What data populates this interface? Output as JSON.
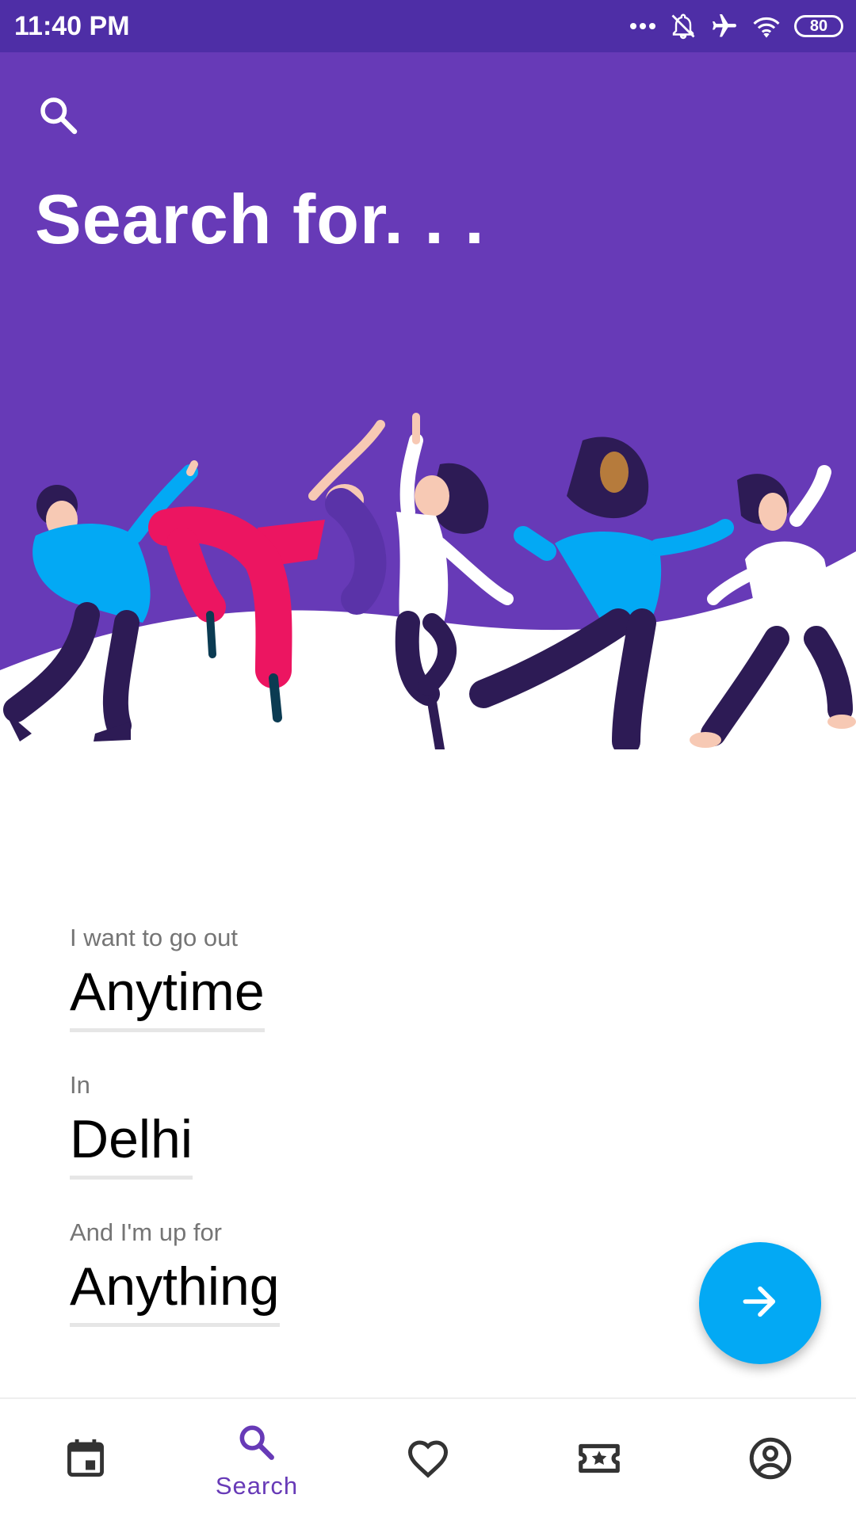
{
  "status_bar": {
    "time": "11:40 PM",
    "battery": "80",
    "icons": [
      "more-dots-icon",
      "notifications-off-icon",
      "airplane-mode-icon",
      "wifi-icon",
      "battery-icon"
    ]
  },
  "header": {
    "title": "Search for. . .",
    "search_icon": "search-icon",
    "background_color": "#673ab7"
  },
  "form": {
    "when": {
      "label": "I want to go out",
      "value": "Anytime"
    },
    "where": {
      "label": "In",
      "value": "Delhi"
    },
    "what": {
      "label": "And I'm up for",
      "value": "Anything"
    }
  },
  "fab": {
    "icon": "arrow-forward-icon",
    "color": "#03a9f4"
  },
  "bottom_nav": {
    "items": [
      {
        "icon": "calendar-icon",
        "label": "",
        "active": false
      },
      {
        "icon": "search-icon",
        "label": "Search",
        "active": true
      },
      {
        "icon": "heart-icon",
        "label": "",
        "active": false
      },
      {
        "icon": "ticket-icon",
        "label": "",
        "active": false
      },
      {
        "icon": "account-icon",
        "label": "",
        "active": false
      }
    ],
    "active_color": "#673ab7"
  }
}
